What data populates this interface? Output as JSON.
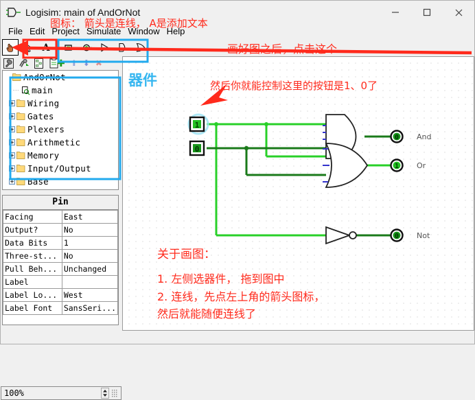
{
  "window": {
    "title": "Logisim: main of AndOrNot",
    "app_icon": "logisim-gate-icon",
    "minimize_label": "─",
    "maximize_label": "□",
    "close_label": "✕"
  },
  "menu": {
    "items": [
      {
        "label": "File"
      },
      {
        "label": "Edit"
      },
      {
        "label": "Project"
      },
      {
        "label": "Simulate"
      },
      {
        "label": "Window"
      },
      {
        "label": "Help"
      }
    ]
  },
  "toolbar": {
    "items": [
      {
        "name": "poke-tool",
        "icon": "hand-pointer-icon",
        "selected": true
      },
      {
        "name": "select-tool",
        "icon": "arrow-cursor-icon",
        "selected": false
      },
      {
        "name": "text-tool",
        "icon": "letter-a-icon",
        "selected": false
      },
      {
        "name": "pin-input-tool",
        "icon": "input-pin-icon",
        "selected": false
      },
      {
        "name": "pin-output-tool",
        "icon": "output-pin-icon",
        "selected": false
      },
      {
        "name": "not-gate-tool",
        "icon": "not-gate-icon",
        "selected": false
      },
      {
        "name": "and-gate-tool",
        "icon": "and-gate-icon",
        "selected": false
      },
      {
        "name": "or-gate-tool",
        "icon": "or-gate-icon",
        "selected": false
      }
    ]
  },
  "explorer": {
    "toolbar": [
      {
        "name": "add-circuit-button",
        "icon": "plus-icon",
        "glyph": "✚",
        "color": "#1a9a1a"
      },
      {
        "name": "move-up-button",
        "icon": "arrow-up-icon",
        "glyph": "⬆",
        "color": "#9aa6d8"
      },
      {
        "name": "move-down-button",
        "icon": "arrow-down-icon",
        "glyph": "⬇",
        "color": "#7f8fd6"
      },
      {
        "name": "delete-button",
        "icon": "cross-icon",
        "glyph": "✖",
        "color": "#e08f8f"
      }
    ],
    "tree": [
      {
        "label": "AndOrNot",
        "icon": "folder-icon",
        "level": 0,
        "expandable": false
      },
      {
        "label": "main",
        "icon": "circuit-icon",
        "level": 1,
        "expandable": false
      },
      {
        "label": "Wiring",
        "icon": "folder-icon",
        "level": 1,
        "expandable": true
      },
      {
        "label": "Gates",
        "icon": "folder-icon",
        "level": 1,
        "expandable": true
      },
      {
        "label": "Plexers",
        "icon": "folder-icon",
        "level": 1,
        "expandable": true
      },
      {
        "label": "Arithmetic",
        "icon": "folder-icon",
        "level": 1,
        "expandable": true
      },
      {
        "label": "Memory",
        "icon": "folder-icon",
        "level": 1,
        "expandable": true
      },
      {
        "label": "Input/Output",
        "icon": "folder-icon",
        "level": 1,
        "expandable": true
      },
      {
        "label": "Base",
        "icon": "folder-icon",
        "level": 1,
        "expandable": true
      }
    ]
  },
  "properties": {
    "title": "Pin",
    "rows": [
      {
        "key": "Facing",
        "value": "East"
      },
      {
        "key": "Output?",
        "value": "No"
      },
      {
        "key": "Data Bits",
        "value": "1"
      },
      {
        "key": "Three-st...",
        "value": "No"
      },
      {
        "key": "Pull Beh...",
        "value": "Unchanged"
      },
      {
        "key": "Label",
        "value": ""
      },
      {
        "key": "Label Lo...",
        "value": "West"
      },
      {
        "key": "Label Font",
        "value": "SansSeri..."
      }
    ]
  },
  "statusbar": {
    "zoom": "100%",
    "spinner_up": "▲",
    "spinner_down": "▼"
  },
  "canvas": {
    "watermark": "器件",
    "pins": [
      {
        "name": "input-pin-1",
        "value": "1",
        "state": "high"
      },
      {
        "name": "input-pin-2",
        "value": "0",
        "state": "low"
      }
    ],
    "gates": [
      {
        "name": "and-gate",
        "label": "And",
        "output": "0",
        "state": "low"
      },
      {
        "name": "or-gate",
        "label": "Or",
        "output": "1",
        "state": "high"
      },
      {
        "name": "not-gate",
        "label": "Not",
        "output": "0",
        "state": "low"
      }
    ],
    "colors": {
      "wire_high": "#28d028",
      "wire_low": "#1a7a1a",
      "gate_stroke": "#000000",
      "watermark": "#35b6f0"
    }
  },
  "annotations": {
    "icon_hint": "图标： 箭头是连线， A是添加文本",
    "click_this": "画好图之后，点击这个",
    "control_buttons": "然后你就能控制这里的按钮是1、0了",
    "about_drawing": "关于画图：",
    "step1": "1. 左侧选器件， 拖到图中",
    "step2": "2. 连线，先点左上角的箭头图标，",
    "step3": "然后就能随便连线了",
    "accent_red": "#ff2a1c",
    "accent_blue": "#22aaee"
  }
}
